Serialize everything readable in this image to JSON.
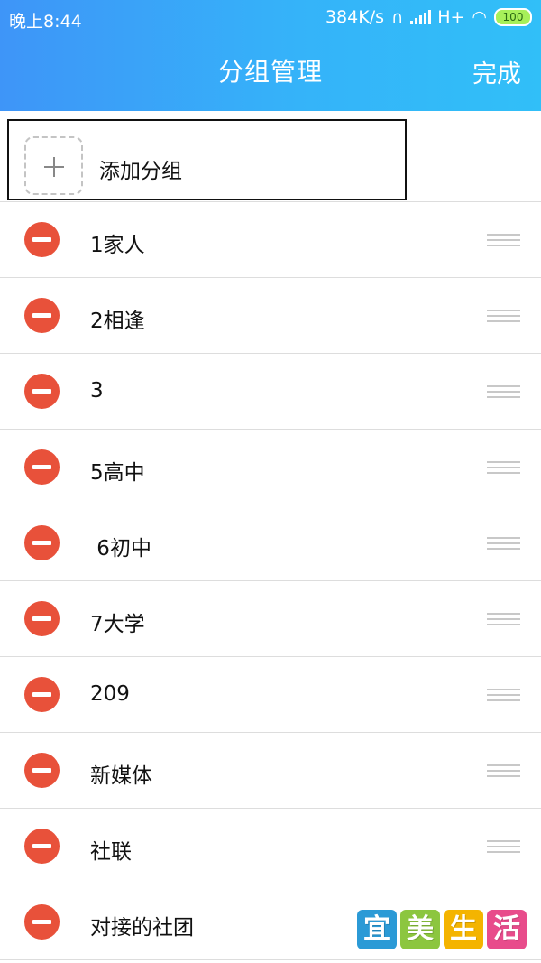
{
  "status_bar": {
    "time": "晚上8:44",
    "network_speed": "384K/s",
    "network_type": "H+",
    "battery": "100"
  },
  "header": {
    "title": "分组管理",
    "done_label": "完成",
    "gradient_start": "#3e95f8",
    "gradient_end": "#31bff8"
  },
  "add_group": {
    "label": "添加分组"
  },
  "groups": [
    {
      "label": "1家人"
    },
    {
      "label": "2相逢"
    },
    {
      "label": "3"
    },
    {
      "label": "5高中"
    },
    {
      "label": " 6初中"
    },
    {
      "label": "7大学"
    },
    {
      "label": "209"
    },
    {
      "label": "新媒体"
    },
    {
      "label": "社联"
    },
    {
      "label": "对接的社团"
    }
  ],
  "colors": {
    "remove_button": "#e8513a",
    "divider": "#dddddd"
  },
  "watermark": {
    "chars": [
      "宜",
      "美",
      "生",
      "活"
    ],
    "colors": [
      "#2b9ad6",
      "#8cc63f",
      "#f4b400",
      "#e84c8b"
    ]
  }
}
